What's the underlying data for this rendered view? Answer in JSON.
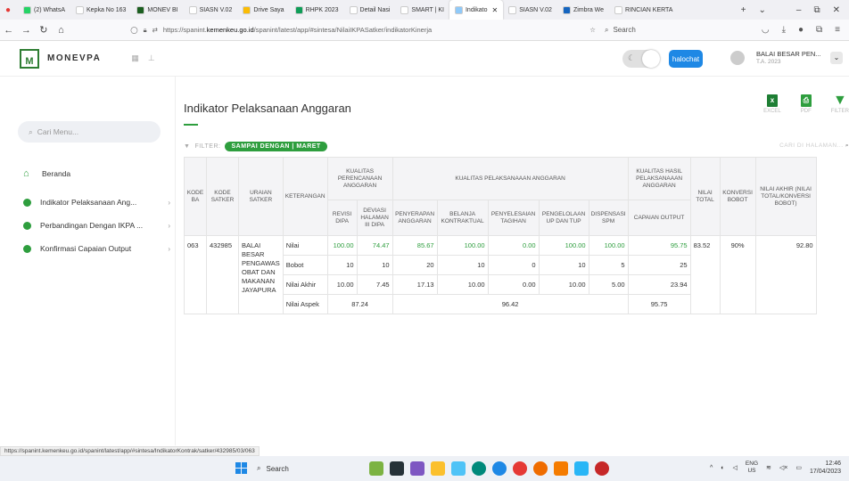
{
  "browser": {
    "tabs": [
      {
        "label": "(2) WhatsA",
        "color": "#25d366",
        "active": false
      },
      {
        "label": "Kepka No 163",
        "color": "#ffffff",
        "active": false
      },
      {
        "label": "MONEV BI",
        "color": "#1b5e20",
        "active": false
      },
      {
        "label": "SIASN V.02",
        "color": "#ffffff",
        "active": false
      },
      {
        "label": "Drive Saya",
        "color": "#fbbc04",
        "active": false
      },
      {
        "label": "RHPK 2023",
        "color": "#0f9d58",
        "active": false
      },
      {
        "label": "Detail Nasi",
        "color": "#ffffff",
        "active": false
      },
      {
        "label": "SMART | KI",
        "color": "#ffffff",
        "active": false
      },
      {
        "label": "Indikato",
        "color": "#90caf9",
        "active": true
      },
      {
        "label": "SIASN V.02",
        "color": "#ffffff",
        "active": false
      },
      {
        "label": "Zimbra We",
        "color": "#1565c0",
        "active": false
      },
      {
        "label": "RINCIAN KERTA",
        "color": "#ffffff",
        "active": false
      }
    ],
    "url_prefix": "https://spanint.",
    "url_domain": "kemenkeu.go.id",
    "url_suffix": "/spanint/latest/app/#sintesa/NilaiIKPASatker/indikatorKinerja",
    "search_placeholder": "Search"
  },
  "app": {
    "brand": "MONEVPA",
    "halo_label": "halochat",
    "user_name": "BALAI BESAR PEN...",
    "user_ta": "T.A. 2023"
  },
  "sidebar": {
    "search_placeholder": "Cari Menu...",
    "home_label": "Beranda",
    "items": [
      {
        "label": "Indikator Pelaksanaan Ang..."
      },
      {
        "label": "Perbandingan Dengan IKPA ..."
      },
      {
        "label": "Konfirmasi Capaian Output"
      }
    ]
  },
  "main": {
    "title": "Indikator Pelaksanaan Anggaran",
    "actions": {
      "excel": "EXCEL",
      "pdf": "PDF",
      "filter": "FILTER"
    },
    "filter_label": "FILTER:",
    "filter_pill": "SAMPAI DENGAN | MARET",
    "search_hint": "CARI DI HALAMAN..."
  },
  "table": {
    "headers": {
      "kode_ba": "KODE BA",
      "kode_satker": "KODE SATKER",
      "uraian_satker": "URAIAN SATKER",
      "keterangan": "KETERANGAN",
      "kualitas_perencanaan": "KUALITAS PERENCANAAN ANGGARAN",
      "kualitas_pelaksanaan": "KUALITAS PELAKSANAAAN ANGGARAN",
      "kualitas_hasil": "KUALITAS HASIL PELAKSANAAAN ANGGARAN",
      "nilai_total": "NILAI TOTAL",
      "konversi_bobot": "KONVERSI BOBOT",
      "nilai_akhir": "NILAI AKHIR (NILAI TOTAL/KONVERSI BOBOT)",
      "revisi_dipa": "REVISI DIPA",
      "deviasi": "DEVIASI HALAMAN III DIPA",
      "penyerapan": "PENYERAPAN ANGGARAN",
      "belanja_kontraktual": "BELANJA KONTRAKTUAL",
      "penyelesaian_tagihan": "PENYELESAIAN TAGIHAN",
      "pengelolaan_up": "PENGELOLAAN UP DAN TUP",
      "dispensasi_spm": "DISPENSASI SPM",
      "capaian_output": "CAPAIAN OUTPUT"
    },
    "kode_ba": "063",
    "kode_satker": "432985",
    "uraian_satker": "BALAI BESAR PENGAWAS OBAT DAN MAKANAN JAYAPURA",
    "nilai_total": "83.52",
    "konversi_bobot": "90%",
    "nilai_akhir": "92.80",
    "rows": [
      {
        "ket": "Nilai",
        "v": [
          "100.00",
          "74.47",
          "85.67",
          "100.00",
          "0.00",
          "100.00",
          "100.00",
          "95.75"
        ]
      },
      {
        "ket": "Bobot",
        "v": [
          "10",
          "10",
          "20",
          "10",
          "0",
          "10",
          "5",
          "25"
        ]
      },
      {
        "ket": "Nilai Akhir",
        "v": [
          "10.00",
          "7.45",
          "17.13",
          "10.00",
          "0.00",
          "10.00",
          "5.00",
          "23.94"
        ]
      }
    ],
    "aspek": {
      "ket": "Nilai Aspek",
      "perencanaan": "87.24",
      "pelaksanaan": "96.42",
      "hasil": "95.75"
    }
  },
  "statusbar": "https://spanint.kemenkeu.go.id/spanint/latest/app/#sintesa/IndikatorKontrak/satker/432985/03/063",
  "taskbar": {
    "search": "Search",
    "lang": "ENG",
    "lang_sub": "US",
    "time": "12:46",
    "date": "17/04/2023"
  }
}
